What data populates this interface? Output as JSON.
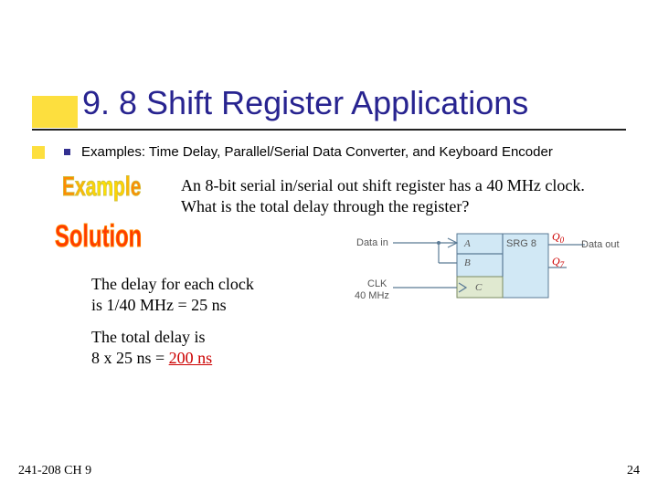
{
  "title": "9. 8 Shift Register Applications",
  "bullet": "Examples: Time Delay, Parallel/Serial Data Converter, and Keyboard Encoder",
  "wordart": {
    "example": "Example",
    "solution": "Solution"
  },
  "example_body": "An 8-bit serial in/serial out shift register has a 40 MHz clock. What is the total delay through the register?",
  "solution_lines": {
    "line1a": "The delay for each clock",
    "line1b": "is 1/40 MHz = 25 ns",
    "line2a": "The total delay is",
    "line2b_pre": "8 x 25 ns = ",
    "line2b_ans": "200 ns"
  },
  "diagram": {
    "data_in": "Data in",
    "clk": "CLK",
    "clk_freq": "40 MHz",
    "A": "A",
    "B": "B",
    "C": "C",
    "srg": "SRG 8",
    "q0": "Q",
    "q0_sub": "0",
    "q7": "Q",
    "q7_sub": "7",
    "data_out": "Data out"
  },
  "footer": {
    "left": "241-208 CH 9",
    "right": "24"
  }
}
